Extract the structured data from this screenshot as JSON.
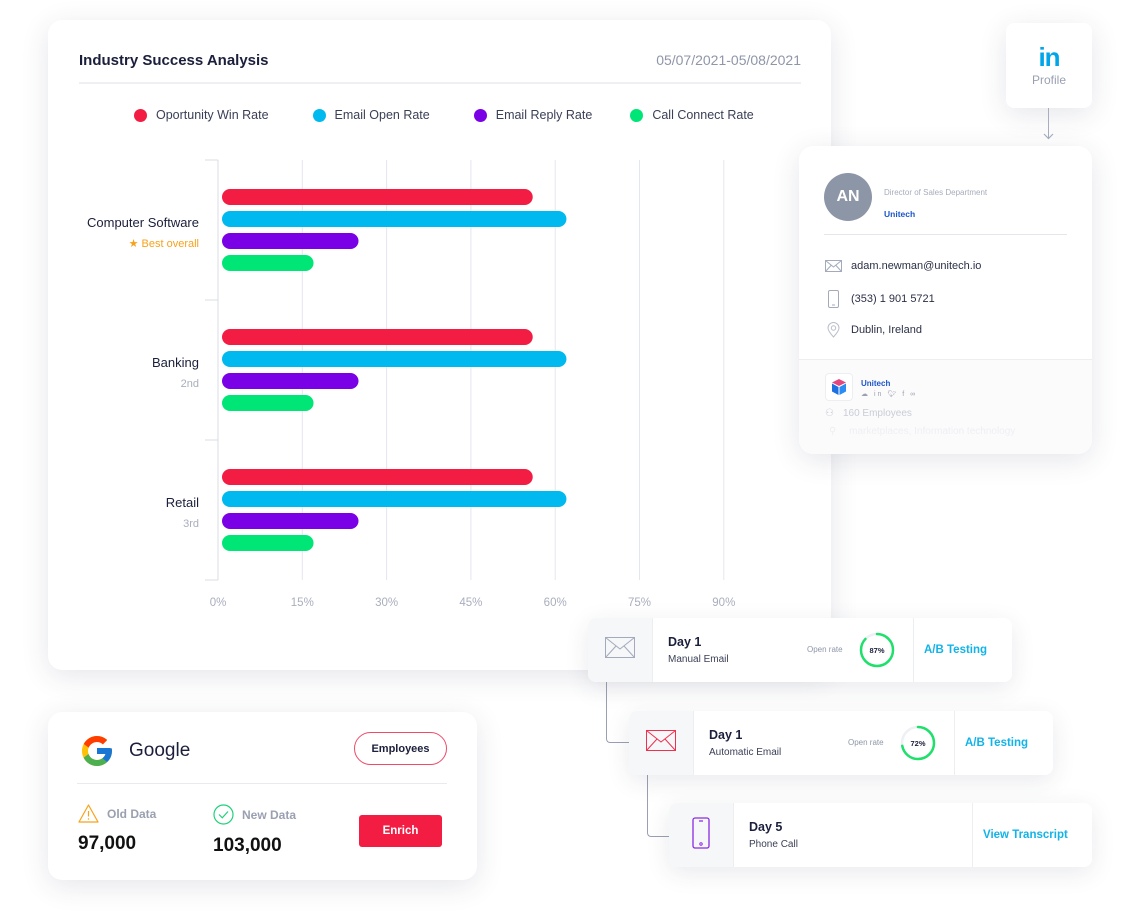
{
  "chart": {
    "title": "Industry Success Analysis",
    "date_range": "05/07/2021-05/08/2021"
  },
  "chart_data": {
    "type": "bar",
    "orientation": "horizontal",
    "title": "Industry Success Analysis",
    "xlabel": "",
    "ylabel": "",
    "xlim": [
      0,
      90
    ],
    "x_ticks": [
      "0%",
      "15%",
      "30%",
      "45%",
      "60%",
      "75%",
      "90%"
    ],
    "grid": true,
    "legend_position": "top",
    "categories": [
      "Computer Software",
      "Banking",
      "Retail"
    ],
    "category_subtitles": [
      "Best overall",
      "2nd",
      "3rd"
    ],
    "series": [
      {
        "name": "Oportunity Win Rate",
        "color": "#f31c43",
        "values": [
          56,
          56,
          56
        ]
      },
      {
        "name": "Email Open Rate",
        "color": "#00b9ef",
        "values": [
          62,
          62,
          62
        ]
      },
      {
        "name": "Email Reply Rate",
        "color": "#7a00e6",
        "values": [
          25,
          25,
          25
        ]
      },
      {
        "name": "Call Connect Rate",
        "color": "#00e676",
        "values": [
          17,
          17,
          17
        ]
      }
    ]
  },
  "linkedin": {
    "logo": "in",
    "label": "Profile"
  },
  "contact": {
    "initials": "AN",
    "role": "Director of Sales Department",
    "company": "Unitech",
    "email": "adam.newman@unitech.io",
    "phone": "(353) 1 901 5721",
    "location": "Dublin, Ireland",
    "company_info": {
      "name": "Unitech",
      "socials": [
        "cloud",
        "linkedin",
        "twitter",
        "facebook",
        "link"
      ],
      "employees": "160 Employees",
      "industry": "marketplaces, Information technology"
    }
  },
  "steps": [
    {
      "day": "Day 1",
      "type": "Manual Email",
      "icon": "mail-icon",
      "rate_label": "Open rate",
      "rate": "87%",
      "rate_value": 87,
      "action": "A/B Testing"
    },
    {
      "day": "Day 1",
      "type": "Automatic Email",
      "icon": "mail-icon",
      "rate_label": "Open rate",
      "rate": "72%",
      "rate_value": 72,
      "action": "A/B Testing"
    },
    {
      "day": "Day 5",
      "type": "Phone Call",
      "icon": "phone-icon",
      "action": "View Transcript"
    }
  ],
  "enrich": {
    "company": "Google",
    "employees_button": "Employees",
    "old_label": "Old Data",
    "old_value": "97,000",
    "new_label": "New Data",
    "new_value": "103,000",
    "enrich_button": "Enrich"
  }
}
